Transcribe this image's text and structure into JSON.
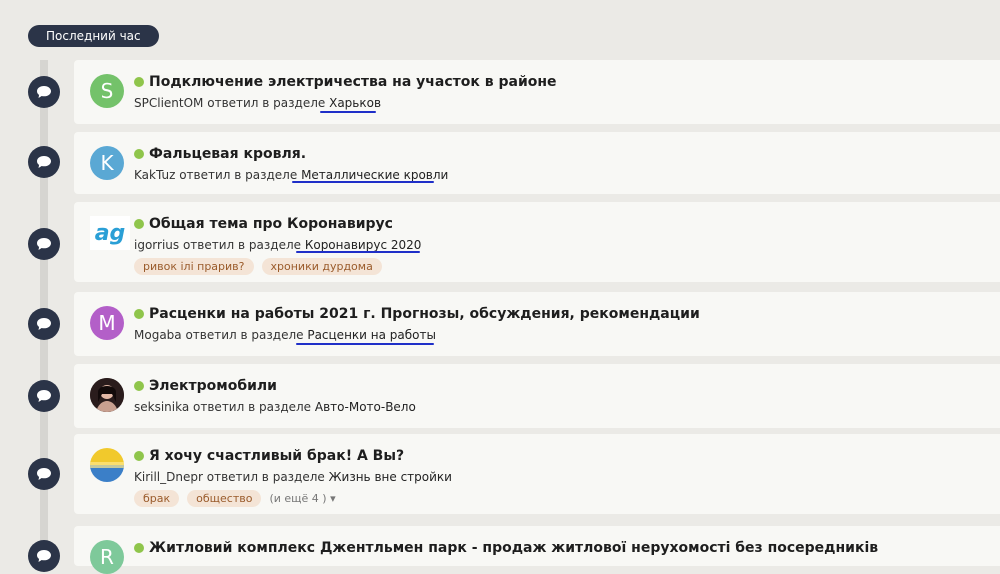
{
  "header": {
    "section_label": "Последний час"
  },
  "colors": {
    "accent_dot": "#8fc54b",
    "bubble": "#2b3448",
    "underline": "#1f2fc8"
  },
  "threads": [
    {
      "avatar_letter": "S",
      "avatar_color": "#74c26a",
      "title": "Подключение электричества на участок в районе",
      "user": "SPClientOM",
      "action": "ответил в разделе",
      "forum": "Харьков"
    },
    {
      "avatar_letter": "K",
      "avatar_color": "#5aa8d4",
      "title": "Фальцевая кровля.",
      "user": "KakTuz",
      "action": "ответил в разделе",
      "forum": "Металлические кровли"
    },
    {
      "avatar_text": "ag",
      "title": "Общая тема про Коронавирус",
      "user": "igorrius",
      "action": "ответил в разделе",
      "forum": "Коронавирус 2020",
      "tags": [
        "ривок ілі прарив?",
        "хроники дурдома"
      ]
    },
    {
      "avatar_letter": "M",
      "avatar_color": "#b35fc8",
      "title": "Расценки на работы 2021 г. Прогнозы, обсуждения, рекомендации",
      "user": "Mogaba",
      "action": "ответил в разделе",
      "forum": "Расценки на работы"
    },
    {
      "avatar_photo": "woman",
      "title": "Электромобили",
      "user": "seksinika",
      "action": "ответил в разделе",
      "forum": "Авто-Мото-Вело"
    },
    {
      "avatar_photo": "flag",
      "title": "Я хочу счастливый брак! А Вы?",
      "user": "Kirill_Dnepr",
      "action": "ответил в разделе",
      "forum": "Жизнь вне стройки",
      "tags": [
        "брак",
        "общество"
      ],
      "more_tags": "(и ещё 4 )"
    },
    {
      "avatar_letter": "R",
      "avatar_color": "#7ec99a",
      "title": "Житловий комплекс Джентльмен парк - продаж житлової нерухомості без посередників"
    }
  ]
}
